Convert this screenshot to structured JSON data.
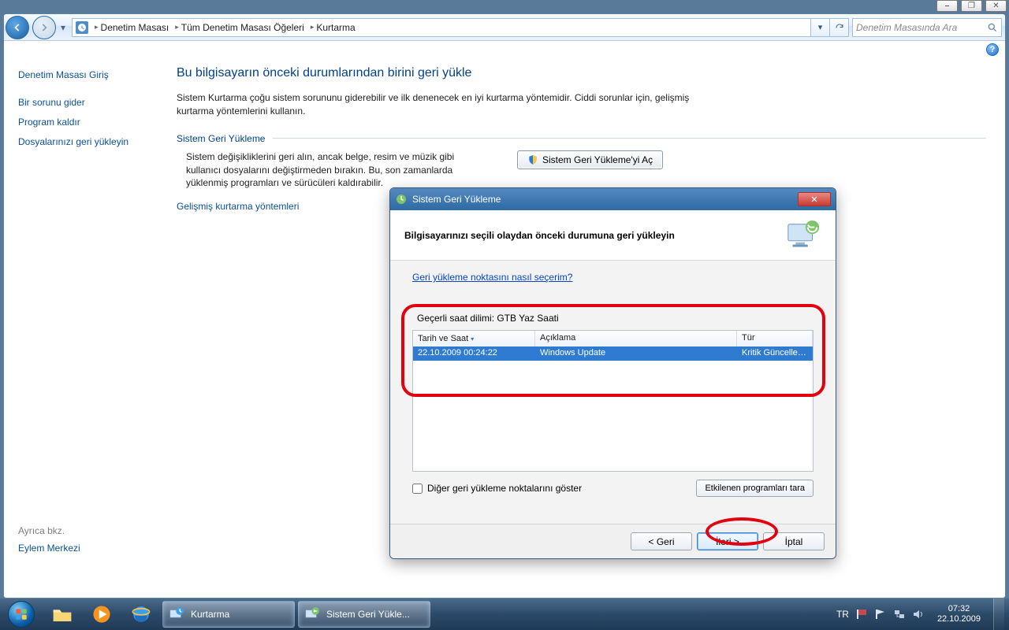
{
  "breadcrumb": {
    "a": "Denetim Masası",
    "b": "Tüm Denetim Masası Öğeleri",
    "c": "Kurtarma"
  },
  "search": {
    "placeholder": "Denetim Masasında Ara"
  },
  "sidebar": {
    "home": "Denetim Masası Giriş",
    "l1": "Bir sorunu gider",
    "l2": "Program kaldır",
    "l3": "Dosyalarınızı geri yükleyin",
    "also_hdr": "Ayrıca bkz.",
    "also1": "Eylem Merkezi"
  },
  "content": {
    "title": "Bu bilgisayarın önceki durumlarından birini geri yükle",
    "lead": "Sistem Kurtarma çoğu sistem sorununu giderebilir ve ilk denenecek en iyi kurtarma yöntemidir. Ciddi sorunlar için, gelişmiş kurtarma yöntemlerini kullanın.",
    "fs_legend": "Sistem Geri Yükleme",
    "fs_text": "Sistem değişikliklerini geri alın, ancak belge, resim ve müzik gibi kullanıcı dosyalarını değiştirmeden bırakın. Bu, son zamanlarda yüklenmiş programları ve sürücüleri kaldırabilir.",
    "openbtn": "Sistem Geri Yükleme'yi Aç",
    "advlink": "Gelişmiş kurtarma yöntemleri"
  },
  "wizard": {
    "title": "Sistem Geri Yükleme",
    "heading": "Bilgisayarınızı seçili olaydan önceki durumuna geri yükleyin",
    "helplink": "Geri yükleme noktasını nasıl seçerim?",
    "tz": "Geçerli saat dilimi: GTB Yaz Saati",
    "col1": "Tarih ve Saat",
    "col2": "Açıklama",
    "col3": "Tür",
    "row_date": "22.10.2009 00:24:22",
    "row_desc": "Windows Update",
    "row_type": "Kritik Güncelleşti...",
    "chk": "Diğer geri yükleme noktalarını göster",
    "scan": "Etkilenen programları tara",
    "back": "< Geri",
    "next": "İleri >",
    "cancel": "İptal"
  },
  "taskbar": {
    "task1": "Kurtarma",
    "task2": "Sistem Geri Yükle...",
    "lang": "TR",
    "time": "07:32",
    "date": "22.10.2009"
  },
  "winctl": {
    "min": "—",
    "max": "❐",
    "close": "✕"
  }
}
